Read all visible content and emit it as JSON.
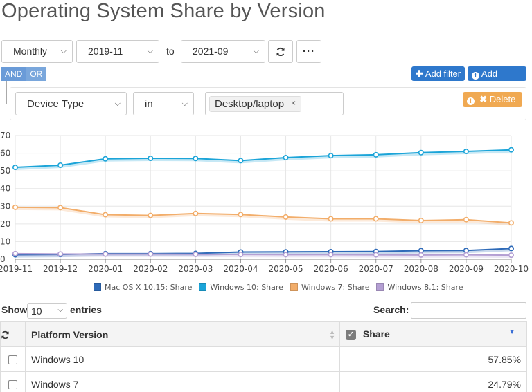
{
  "page": {
    "title": "Operating System Share by Version"
  },
  "controls": {
    "period": "Monthly",
    "from": "2019-11",
    "to_label": "to",
    "to": "2021-09",
    "refresh_icon": "refresh-icon",
    "more_icon": "ellipsis-icon"
  },
  "filter": {
    "and_label": "AND",
    "or_label": "OR",
    "add_filter_label": "Add filter",
    "add_group_label": "Add group",
    "field": "Device Type",
    "operator": "in",
    "value": "Desktop/laptop",
    "remove_symbol": "×",
    "delete_label": "Delete"
  },
  "chart_data": {
    "type": "line",
    "x": [
      "2019-11",
      "2019-12",
      "2020-01",
      "2020-02",
      "2020-03",
      "2020-04",
      "2020-05",
      "2020-06",
      "2020-07",
      "2020-08",
      "2020-09",
      "2020-10"
    ],
    "ylim": [
      0,
      70
    ],
    "yticks": [
      0,
      10,
      20,
      30,
      40,
      50,
      60,
      70
    ],
    "grid": true,
    "legend_position": "bottom",
    "series": [
      {
        "name": "Mac OS X 10.15: Share",
        "color": "#2e6ab8",
        "values": [
          2.5,
          2.7,
          3.2,
          3.2,
          3.3,
          4.1,
          4.2,
          4.3,
          4.4,
          4.9,
          5.0,
          6.1
        ]
      },
      {
        "name": "Windows 10: Share",
        "color": "#1ba4d8",
        "values": [
          52.0,
          53.2,
          56.8,
          57.1,
          57.0,
          55.8,
          57.5,
          58.6,
          59.1,
          60.3,
          61.0,
          61.9
        ]
      },
      {
        "name": "Windows 7: Share",
        "color": "#f2ad6a",
        "values": [
          29.4,
          29.2,
          25.2,
          24.8,
          25.9,
          25.3,
          23.9,
          22.9,
          22.9,
          21.9,
          22.4,
          20.6
        ]
      },
      {
        "name": "Windows 8.1: Share",
        "color": "#b49fd3",
        "values": [
          3.2,
          3.0,
          2.9,
          2.9,
          2.8,
          2.7,
          2.6,
          2.6,
          2.5,
          2.4,
          2.5,
          2.3
        ]
      }
    ]
  },
  "table": {
    "show_label": "Show",
    "entries_value": "10",
    "entries_label": "entries",
    "search_label": "Search:",
    "headers": {
      "name": "Platform Version",
      "share": "Share"
    },
    "rows": [
      {
        "name": "Windows 10",
        "share": "57.85%"
      },
      {
        "name": "Windows 7",
        "share": "24.79%"
      }
    ]
  }
}
